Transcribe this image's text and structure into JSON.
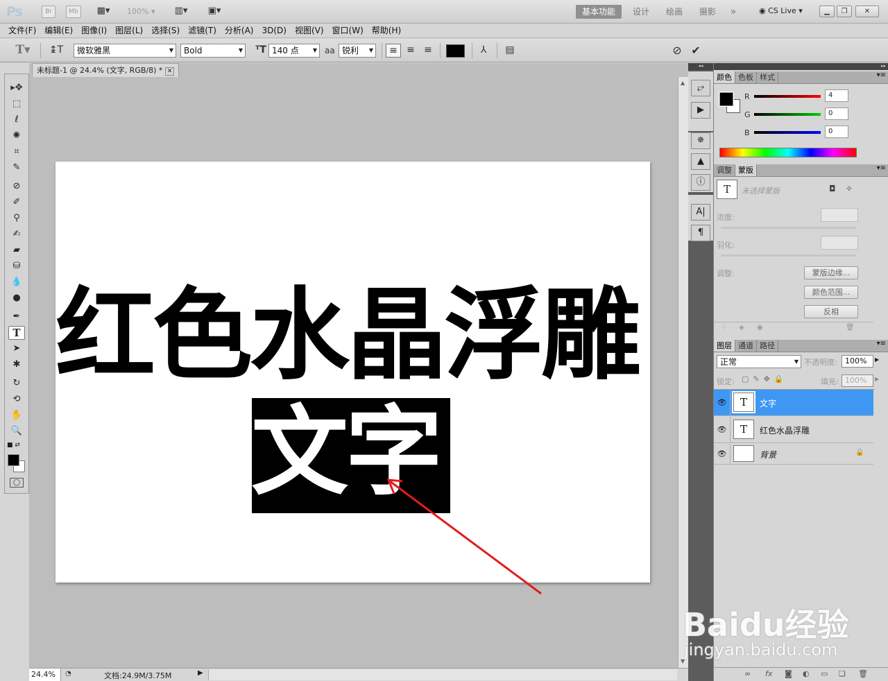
{
  "appbar": {
    "logo": "Ps",
    "bridge": "Br",
    "minibridge": "Mb",
    "zoom": "100%",
    "workspaces": [
      "基本功能",
      "设计",
      "绘画",
      "摄影"
    ],
    "more": "»",
    "cslive": "CS Live"
  },
  "menu": [
    "文件(F)",
    "编辑(E)",
    "图像(I)",
    "图层(L)",
    "选择(S)",
    "滤镜(T)",
    "分析(A)",
    "3D(D)",
    "视图(V)",
    "窗口(W)",
    "帮助(H)"
  ],
  "options": {
    "font_family": "微软雅黑",
    "font_style": "Bold",
    "font_size": "140 点",
    "aa_label": "aa",
    "antialias": "锐利",
    "text_color": "#000000"
  },
  "document": {
    "tab_title": "未标题-1 @ 24.4% (文字, RGB/8) *",
    "line1": "红色水晶浮雕",
    "line2": "文字"
  },
  "status": {
    "zoom": "24.4%",
    "doc_info": "文档:24.9M/3.75M"
  },
  "color_panel": {
    "tabs": [
      "颜色",
      "色板",
      "样式"
    ],
    "r_label": "R",
    "g_label": "G",
    "b_label": "B",
    "r": "4",
    "g": "0",
    "b": "0"
  },
  "mask_panel": {
    "tabs": [
      "调整",
      "蒙版"
    ],
    "no_selection": "未选择蒙版",
    "density": "浓度:",
    "feather": "羽化:",
    "adjust": "调整:",
    "edge_btn": "蒙版边缘...",
    "range_btn": "颜色范围...",
    "invert_btn": "反相"
  },
  "layers_panel": {
    "tabs": [
      "图层",
      "通道",
      "路径"
    ],
    "blend_mode": "正常",
    "opacity_label": "不透明度:",
    "opacity": "100%",
    "lock_label": "锁定:",
    "fill_label": "填充:",
    "fill": "100%",
    "layers": [
      {
        "name": "文字",
        "thumb": "T"
      },
      {
        "name": "红色水晶浮雕",
        "thumb": "T"
      },
      {
        "name": "背景",
        "thumb": ""
      }
    ]
  },
  "watermark": {
    "brand": "Baidu经验",
    "url": "jingyan.baidu.com"
  },
  "colors": {
    "selection": "#3d97f3",
    "arrow": "#e41b1b"
  }
}
